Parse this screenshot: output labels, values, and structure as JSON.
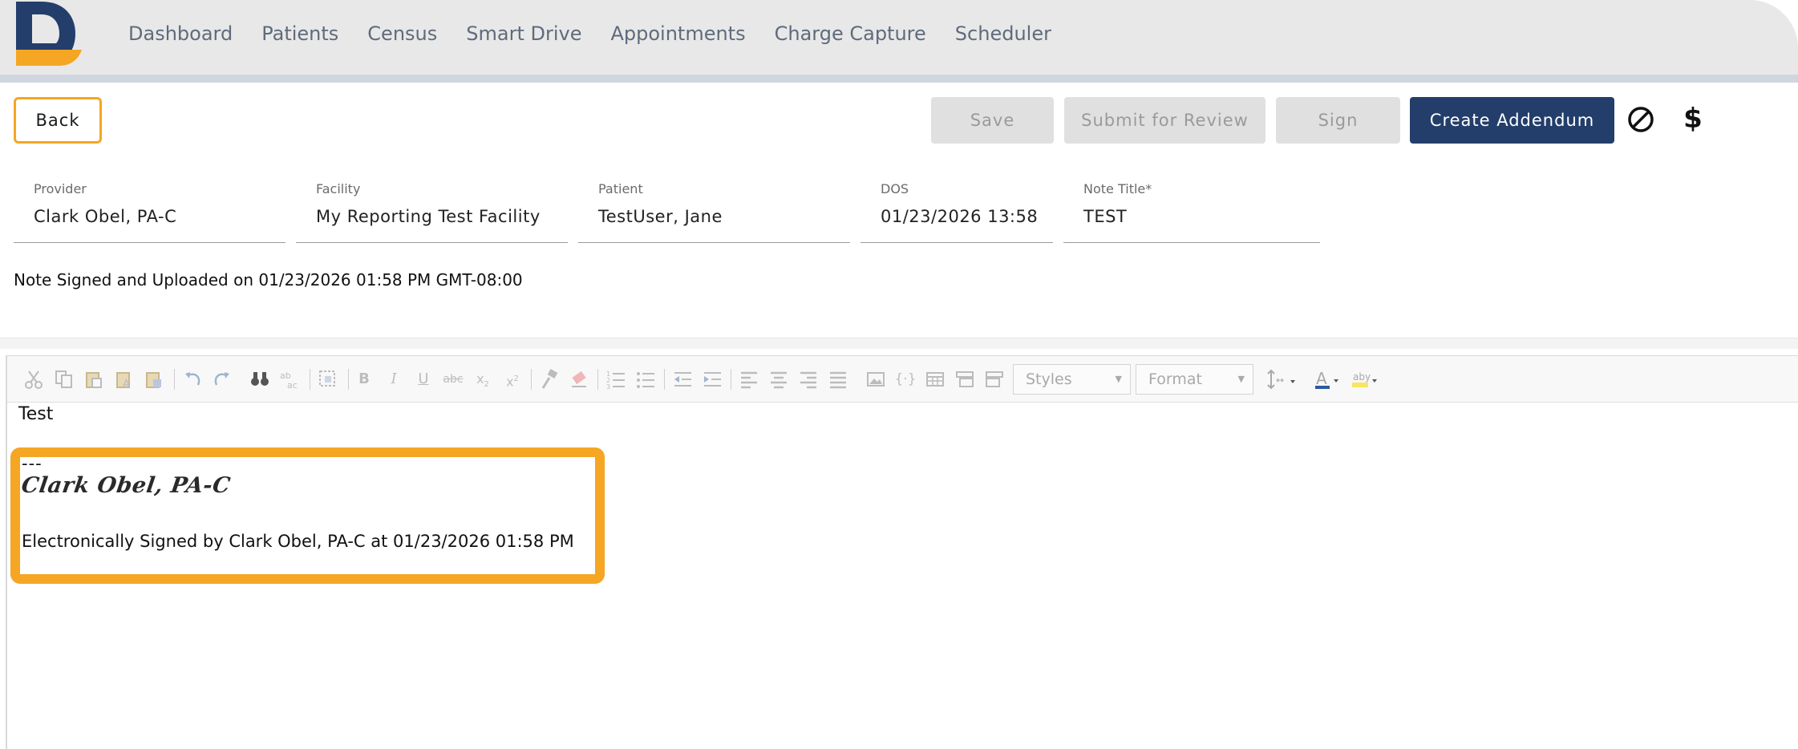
{
  "nav": {
    "items": [
      "Dashboard",
      "Patients",
      "Census",
      "Smart Drive",
      "Appointments",
      "Charge Capture",
      "Scheduler"
    ]
  },
  "actions": {
    "back": "Back",
    "save": "Save",
    "submit_review": "Submit for Review",
    "sign": "Sign",
    "create_addendum": "Create Addendum",
    "dollar_symbol": "$"
  },
  "fields": {
    "provider": {
      "label": "Provider",
      "value": "Clark Obel, PA-C"
    },
    "facility": {
      "label": "Facility",
      "value": "My Reporting Test Facility"
    },
    "patient": {
      "label": "Patient",
      "value": "TestUser, Jane"
    },
    "dos": {
      "label": "DOS",
      "value": "01/23/2026 13:58"
    },
    "note_title": {
      "label": "Note Title*",
      "value": "TEST"
    }
  },
  "signed_status": "Note Signed and Uploaded on 01/23/2026 01:58 PM GMT-08:00",
  "editor": {
    "toolbar": {
      "styles_placeholder": "Styles",
      "format_placeholder": "Format"
    },
    "content": {
      "body": "Test",
      "separator": "---",
      "signature_image_text": "Clark Obel, PA-C",
      "signature_line": "Electronically Signed by Clark Obel, PA-C at 01/23/2026 01:58 PM"
    }
  },
  "colors": {
    "accent_orange": "#f5a623",
    "primary_navy": "#233e6a",
    "nav_text": "#5f6b7c",
    "disabled_button": "#e0e0e0"
  },
  "icons": [
    "logo-icon",
    "cancel-icon",
    "dollar-icon",
    "cut-icon",
    "copy-icon",
    "paste-icon",
    "paste-text-icon",
    "paste-word-icon",
    "undo-icon",
    "redo-icon",
    "find-icon",
    "replace-icon",
    "select-all-icon",
    "bold-icon",
    "italic-icon",
    "underline-icon",
    "strikethrough-icon",
    "subscript-icon",
    "superscript-icon",
    "copy-format-icon",
    "remove-format-icon",
    "numbered-list-icon",
    "bulleted-list-icon",
    "outdent-icon",
    "indent-icon",
    "align-left-icon",
    "align-center-icon",
    "align-right-icon",
    "justify-icon",
    "image-icon",
    "placeholder-icon",
    "table-icon",
    "insert-row-icon",
    "insert-column-icon",
    "line-height-icon",
    "text-color-icon",
    "background-color-icon"
  ]
}
